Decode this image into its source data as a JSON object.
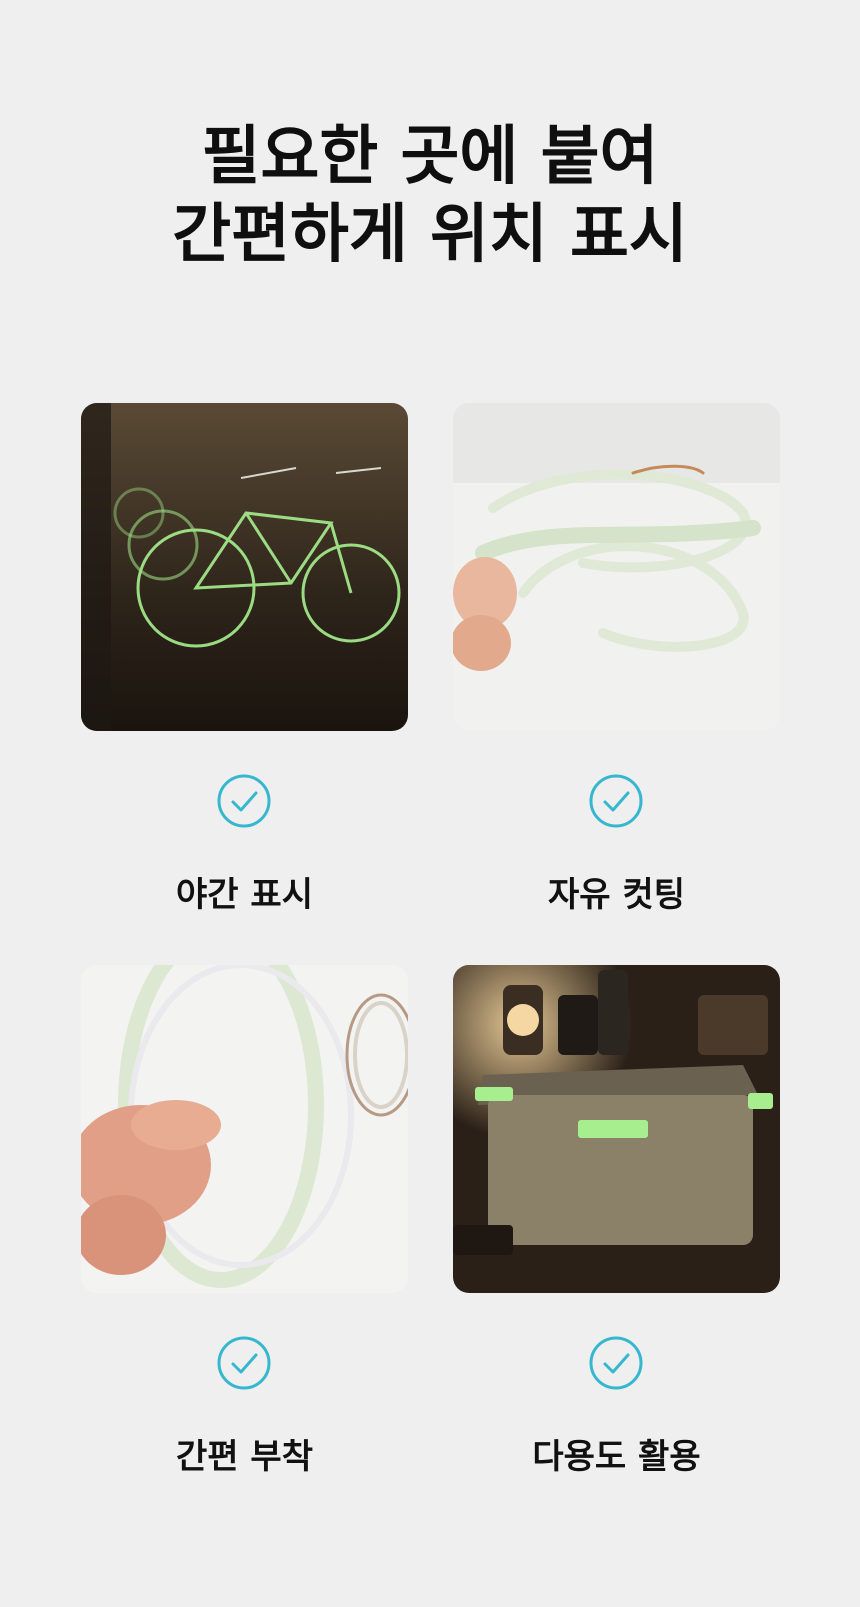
{
  "header": {
    "title_line1": "필요한 곳에 붙여",
    "title_line2": "간편하게 위치 표시"
  },
  "features": [
    {
      "label": "야간 표시",
      "icon": "check-circle-icon"
    },
    {
      "label": "자유 컷팅",
      "icon": "check-circle-icon"
    },
    {
      "label": "간편 부착",
      "icon": "check-circle-icon"
    },
    {
      "label": "다용도 활용",
      "icon": "check-circle-icon"
    }
  ],
  "colors": {
    "background": "#efefef",
    "accent": "#36b7cf",
    "glow": "#a7ef8e",
    "text": "#111111"
  }
}
